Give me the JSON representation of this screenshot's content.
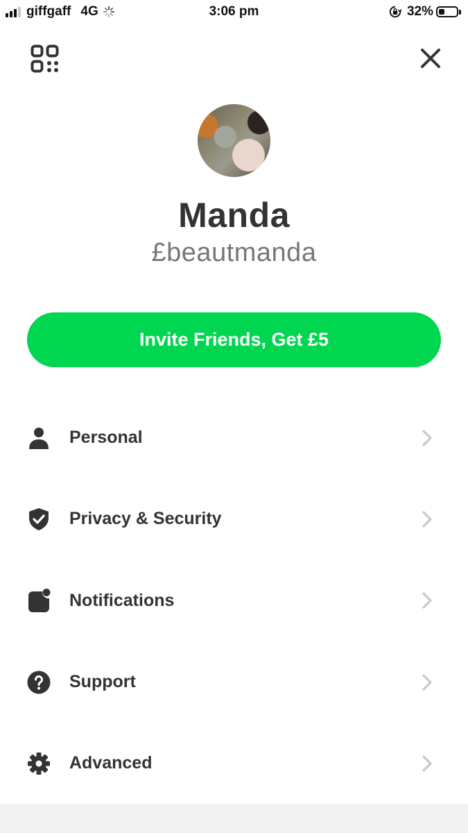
{
  "status_bar": {
    "carrier": "giffgaff",
    "network": "4G",
    "time": "3:06 pm",
    "battery_percent": "32%",
    "battery_level": 0.32,
    "signal_bars": 3
  },
  "header": {
    "qr_icon": "qr-code-icon",
    "close_icon": "close-icon"
  },
  "profile": {
    "name": "Manda",
    "cashtag": "£beautmanda"
  },
  "invite_button": {
    "label": "Invite Friends, Get £5",
    "color": "#00d64f"
  },
  "menu": {
    "items": [
      {
        "label": "Personal",
        "icon": "person-icon"
      },
      {
        "label": "Privacy & Security",
        "icon": "shield-check-icon"
      },
      {
        "label": "Notifications",
        "icon": "notification-badge-icon"
      },
      {
        "label": "Support",
        "icon": "question-icon"
      },
      {
        "label": "Advanced",
        "icon": "gear-icon"
      }
    ]
  }
}
